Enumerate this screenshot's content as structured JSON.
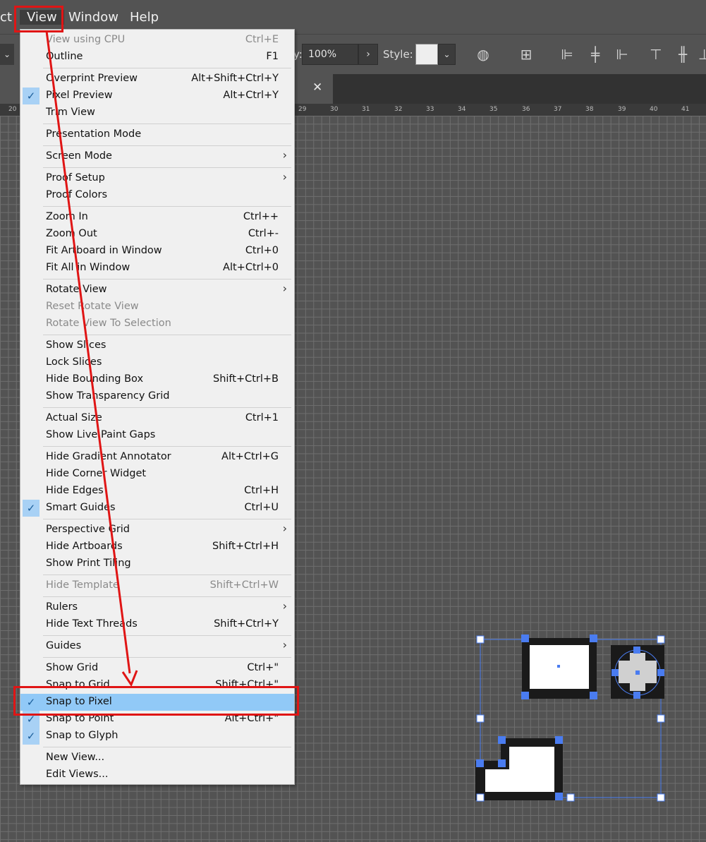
{
  "menubar": {
    "items": [
      "ct",
      "View",
      "Window",
      "Help"
    ]
  },
  "toolbar": {
    "zoom_value": "100%",
    "style_label": "Style:",
    "zoom_label_fragment": "y:"
  },
  "ruler": {
    "ticks": [
      "20",
      "29",
      "30",
      "31",
      "32",
      "33",
      "34",
      "35",
      "36",
      "37",
      "38",
      "39",
      "40",
      "41"
    ]
  },
  "menu": {
    "items": [
      {
        "label": "View using CPU",
        "shortcut": "Ctrl+E",
        "disabled": true
      },
      {
        "label": "Outline",
        "shortcut": "F1"
      },
      {
        "sep": true
      },
      {
        "label": "Overprint Preview",
        "shortcut": "Alt+Shift+Ctrl+Y"
      },
      {
        "label": "Pixel Preview",
        "shortcut": "Alt+Ctrl+Y",
        "checked": true
      },
      {
        "label": "Trim View",
        "shortcut": ""
      },
      {
        "sep": true
      },
      {
        "label": "Presentation Mode",
        "shortcut": ""
      },
      {
        "sep": true
      },
      {
        "label": "Screen Mode",
        "shortcut": "",
        "submenu": true
      },
      {
        "sep": true
      },
      {
        "label": "Proof Setup",
        "shortcut": "",
        "submenu": true
      },
      {
        "label": "Proof Colors",
        "shortcut": ""
      },
      {
        "sep": true
      },
      {
        "label": "Zoom In",
        "shortcut": "Ctrl++"
      },
      {
        "label": "Zoom Out",
        "shortcut": "Ctrl+-"
      },
      {
        "label": "Fit Artboard in Window",
        "shortcut": "Ctrl+0"
      },
      {
        "label": "Fit All in Window",
        "shortcut": "Alt+Ctrl+0"
      },
      {
        "sep": true
      },
      {
        "label": "Rotate View",
        "shortcut": "",
        "submenu": true
      },
      {
        "label": "Reset Rotate View",
        "shortcut": "",
        "disabled": true
      },
      {
        "label": "Rotate View To Selection",
        "shortcut": "",
        "disabled": true
      },
      {
        "sep": true
      },
      {
        "label": "Show Slices",
        "shortcut": ""
      },
      {
        "label": "Lock Slices",
        "shortcut": ""
      },
      {
        "label": "Hide Bounding Box",
        "shortcut": "Shift+Ctrl+B"
      },
      {
        "label": "Show Transparency Grid",
        "shortcut": ""
      },
      {
        "sep": true
      },
      {
        "label": "Actual Size",
        "shortcut": "Ctrl+1"
      },
      {
        "label": "Show Live Paint Gaps",
        "shortcut": ""
      },
      {
        "sep": true
      },
      {
        "label": "Hide Gradient Annotator",
        "shortcut": "Alt+Ctrl+G"
      },
      {
        "label": "Hide Corner Widget",
        "shortcut": ""
      },
      {
        "label": "Hide Edges",
        "shortcut": "Ctrl+H"
      },
      {
        "label": "Smart Guides",
        "shortcut": "Ctrl+U",
        "checked": true
      },
      {
        "sep": true
      },
      {
        "label": "Perspective Grid",
        "shortcut": "",
        "submenu": true
      },
      {
        "label": "Hide Artboards",
        "shortcut": "Shift+Ctrl+H"
      },
      {
        "label": "Show Print Tiling",
        "shortcut": ""
      },
      {
        "sep": true
      },
      {
        "label": "Hide Template",
        "shortcut": "Shift+Ctrl+W",
        "disabled": true
      },
      {
        "sep": true
      },
      {
        "label": "Rulers",
        "shortcut": "",
        "submenu": true
      },
      {
        "label": "Hide Text Threads",
        "shortcut": "Shift+Ctrl+Y"
      },
      {
        "sep": true
      },
      {
        "label": "Guides",
        "shortcut": "",
        "submenu": true
      },
      {
        "sep": true
      },
      {
        "label": "Show Grid",
        "shortcut": "Ctrl+\""
      },
      {
        "label": "Snap to Grid",
        "shortcut": "Shift+Ctrl+\""
      },
      {
        "label": "Snap to Pixel",
        "shortcut": "",
        "checked": true,
        "highlighted": true
      },
      {
        "label": "Snap to Point",
        "shortcut": "Alt+Ctrl+\"",
        "checked": true
      },
      {
        "label": "Snap to Glyph",
        "shortcut": "",
        "checked": true
      },
      {
        "sep": true
      },
      {
        "label": "New View...",
        "shortcut": ""
      },
      {
        "label": "Edit Views...",
        "shortcut": ""
      }
    ]
  },
  "colors": {
    "annotation": "#e01515",
    "selection": "#4a7cf0",
    "highlight": "#91c9f7"
  }
}
